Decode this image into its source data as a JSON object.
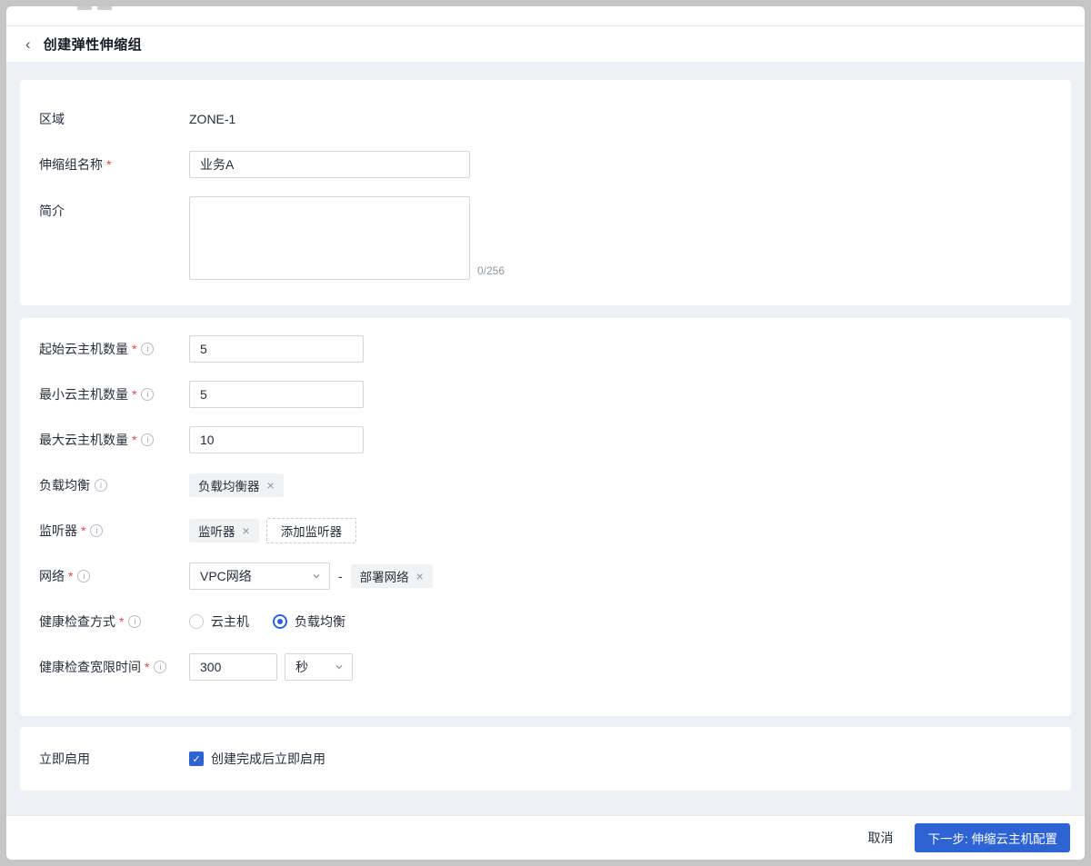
{
  "header": {
    "back_icon": "‹",
    "title": "创建弹性伸缩组"
  },
  "marks": {
    "required": "*",
    "info": "i"
  },
  "icons": {
    "close": "×",
    "check": "✓"
  },
  "panel_basic": {
    "zone_label": "区域",
    "zone_value": "ZONE-1",
    "name_label": "伸缩组名称",
    "name_value": "业务A",
    "intro_label": "简介",
    "intro_value": "",
    "intro_counter": "0/256"
  },
  "panel_config": {
    "start_label": "起始云主机数量",
    "start_value": "5",
    "min_label": "最小云主机数量",
    "min_value": "5",
    "max_label": "最大云主机数量",
    "max_value": "10",
    "lb_label": "负载均衡",
    "lb_tag": "负载均衡器",
    "listener_label": "监听器",
    "listener_tag": "监听器",
    "listener_add": "添加监听器",
    "network_label": "网络",
    "network_select": "VPC网络",
    "network_sep": "-",
    "network_tag": "部署网络",
    "health_label": "健康检查方式",
    "health_options": [
      {
        "label": "云主机",
        "selected": false
      },
      {
        "label": "负载均衡",
        "selected": true
      }
    ],
    "grace_label": "健康检查宽限时间",
    "grace_value": "300",
    "grace_unit": "秒"
  },
  "panel_enable": {
    "label": "立即启用",
    "checkbox_label": "创建完成后立即启用",
    "checked": true
  },
  "footer": {
    "cancel": "取消",
    "next": "下一步: 伸缩云主机配置"
  },
  "colors": {
    "accent": "#2d63d2",
    "required": "#e5484d",
    "content_bg": "#edf0f5",
    "tag_bg": "#f1f2f4"
  }
}
